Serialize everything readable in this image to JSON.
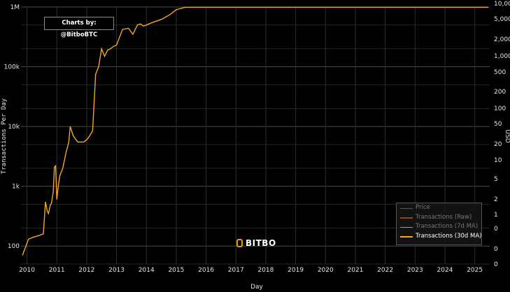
{
  "credit": "Charts by: @BitboBTC",
  "logo_text": "BITBO",
  "colors": {
    "series_30d": "#f5a623",
    "series_7d": "#9a9a9a",
    "series_raw": "#8a4a1a",
    "price": "#555555",
    "grid": "#333333",
    "background": "#000000"
  },
  "legend": [
    {
      "label": "Price",
      "active": false
    },
    {
      "label": "Transactions (Raw)",
      "active": false
    },
    {
      "label": "Transactions (7d MA)",
      "active": false
    },
    {
      "label": "Transactions (30d MA)",
      "active": true
    }
  ],
  "chart_data": {
    "type": "line",
    "xlabel": "Day",
    "ylabel": "Transactions Per Day",
    "y2label": "USD",
    "y_scale": "log",
    "ylim": [
      50,
      1000000
    ],
    "y_ticks": [
      {
        "value": 100,
        "label": "100"
      },
      {
        "value": 1000,
        "label": "1k"
      },
      {
        "value": 10000,
        "label": "10k"
      },
      {
        "value": 100000,
        "label": "100k"
      },
      {
        "value": 1000000,
        "label": "1M"
      }
    ],
    "y2_ticks": [
      "10,000",
      "5,000",
      "2,000",
      "1,000",
      "500",
      "200",
      "100",
      "50",
      "20",
      "10",
      "5",
      "2",
      "1",
      "0",
      "0",
      "0"
    ],
    "x_ticks": [
      "2010",
      "2011",
      "2012",
      "2013",
      "2014",
      "2015",
      "2016",
      "2017",
      "2018",
      "2019",
      "2020",
      "2021",
      "2022",
      "2023",
      "2024",
      "2025"
    ],
    "xlim": [
      2009.8,
      2025.5
    ],
    "grid": true,
    "legend_position": "bottom-right",
    "series": [
      {
        "name": "Transactions (30d MA)",
        "x": [
          2009.85,
          2009.95,
          2010.05,
          2010.2,
          2010.4,
          2010.55,
          2010.62,
          2010.68,
          2010.72,
          2010.78,
          2010.82,
          2010.88,
          2010.92,
          2010.96,
          2011.0,
          2011.05,
          2011.1,
          2011.2,
          2011.3,
          2011.4,
          2011.45,
          2011.55,
          2011.7,
          2011.9,
          2012.0,
          2012.1,
          2012.2,
          2012.3,
          2012.4,
          2012.5,
          2012.6,
          2012.7,
          2012.8,
          2012.9,
          2013.0,
          2013.2,
          2013.4,
          2013.55,
          2013.7,
          2013.8,
          2013.9,
          2014.0,
          2014.2,
          2014.5,
          2014.8,
          2015.0,
          2015.3,
          2015.6,
          2015.8,
          2016.0,
          2016.2,
          2016.5,
          2016.8,
          2017.0,
          2017.3,
          2017.6,
          2017.8,
          2017.9,
          2018.0,
          2018.1,
          2018.2,
          2018.4,
          2018.6,
          2018.8,
          2019.0,
          2019.3,
          2019.6,
          2019.8,
          2020.0,
          2020.3,
          2020.6,
          2020.9,
          2021.1,
          2021.3,
          2021.5,
          2021.7,
          2022.0,
          2022.3,
          2022.6,
          2022.9,
          2023.0,
          2023.2,
          2023.4,
          2023.5,
          2023.7,
          2023.9,
          2024.1,
          2024.3,
          2024.5,
          2024.6,
          2024.8,
          2024.95,
          2025.1,
          2025.3,
          2025.45
        ],
        "y": [
          70,
          95,
          130,
          140,
          150,
          160,
          550,
          380,
          350,
          480,
          520,
          800,
          2100,
          2200,
          600,
          1000,
          1500,
          2000,
          3500,
          5500,
          10000,
          7000,
          5500,
          5500,
          6000,
          7000,
          8500,
          75000,
          100000,
          200000,
          150000,
          190000,
          200000,
          220000,
          230000,
          420000,
          440000,
          350000,
          500000,
          520000,
          480000,
          500000,
          550000,
          620000,
          750000,
          900000,
          1100000,
          1300000,
          1500000,
          1750000,
          1900000,
          2100000,
          2500000,
          3000000,
          2700000,
          3200000,
          2800000,
          3800000,
          3100000,
          2000000,
          1500000,
          1600000,
          1900000,
          2200000,
          2700000,
          3300000,
          3200000,
          3000000,
          3000000,
          3000000,
          2900000,
          2800000,
          2900000,
          2850000,
          1900000,
          2300000,
          2400000,
          2200000,
          2500000,
          2400000,
          2700000,
          4000000,
          4200000,
          3500000,
          4300000,
          5000000,
          5200000,
          3800000,
          5400000,
          5300000,
          5600000,
          4800000,
          3500000,
          3800000,
          4000000
        ]
      }
    ]
  }
}
